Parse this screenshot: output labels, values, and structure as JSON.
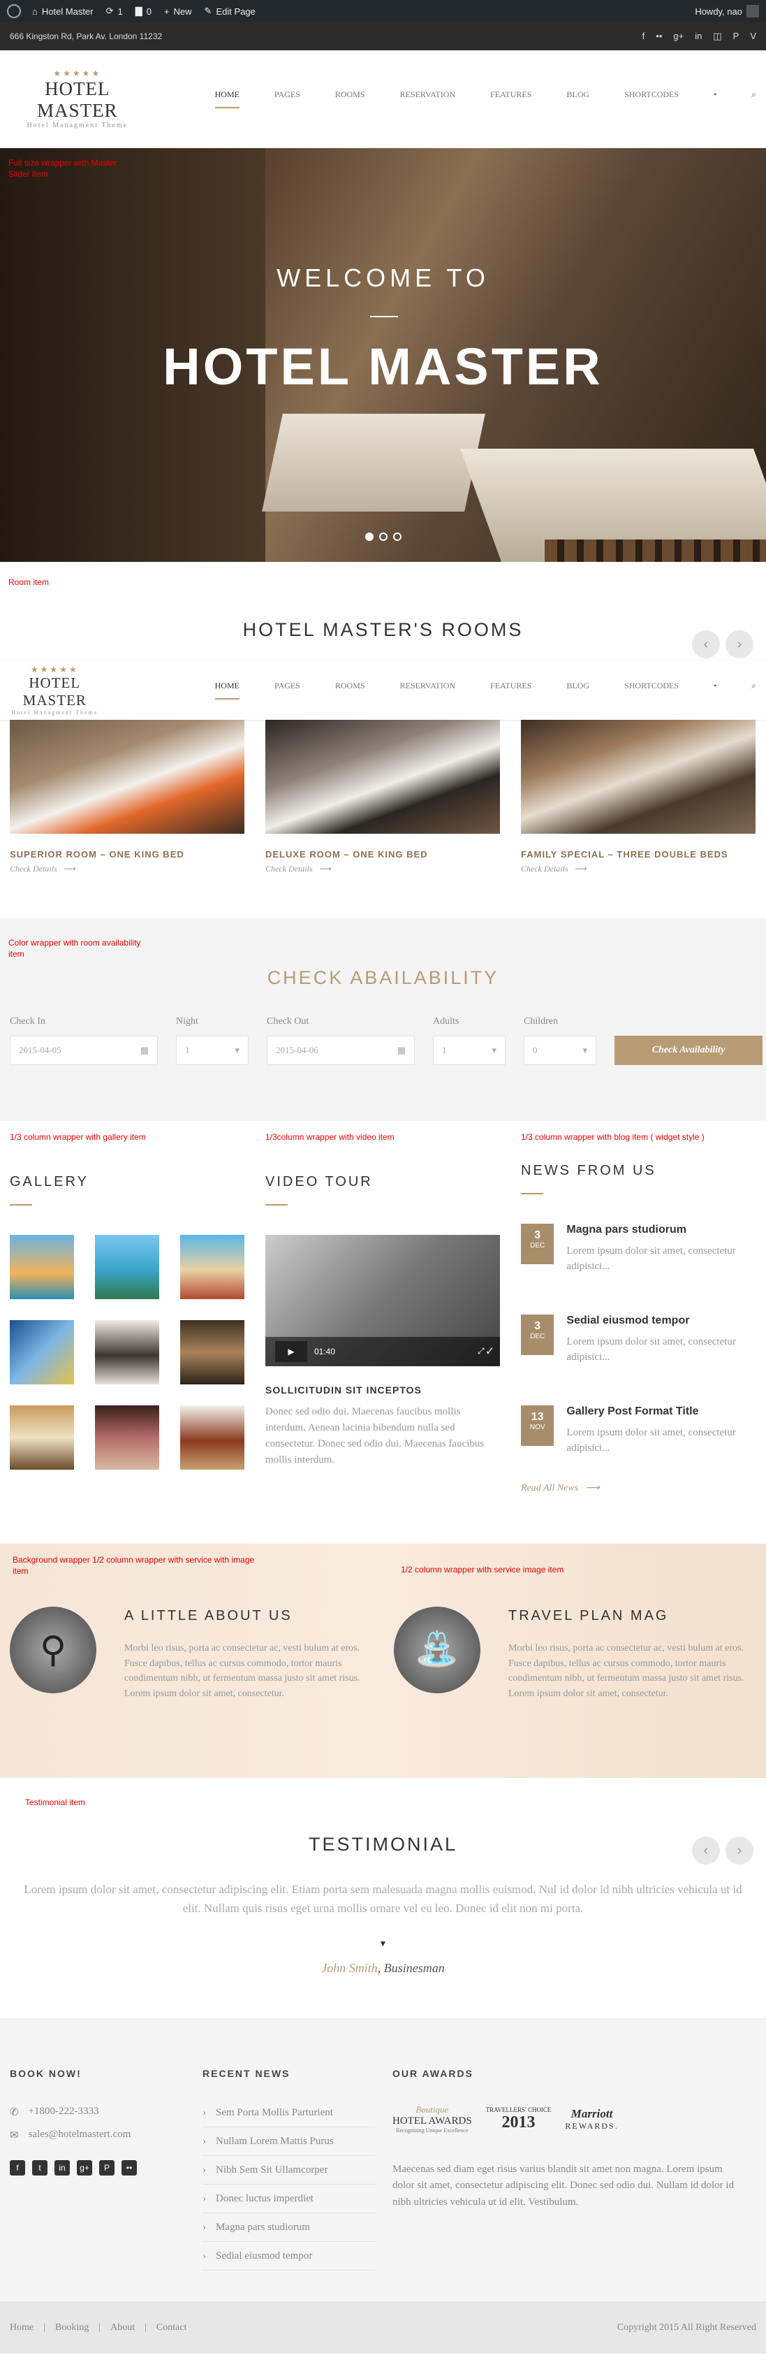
{
  "admin": {
    "site": "Hotel Master",
    "updates": "1",
    "comments": "0",
    "new": "New",
    "edit": "Edit Page",
    "howdy": "Howdy, nao"
  },
  "topbar": {
    "address": "666 Kingston Rd, Park Av. London 11232",
    "social": [
      "f",
      "••",
      "g+",
      "in",
      "◫",
      "P",
      "V"
    ]
  },
  "logo": {
    "stars": "★★★★★",
    "name": "HOTEL MASTER",
    "tagline": "Hotel Managment Theme"
  },
  "nav": {
    "items": [
      "Home",
      "Pages",
      "Rooms",
      "Reservation",
      "Features",
      "Blog",
      "Shortcodes"
    ],
    "dot": "•",
    "search": "⌕"
  },
  "hero": {
    "label": "Full size wrapper with Master Slider item",
    "welcome": "WELCOME TO",
    "title": "HOTEL MASTER"
  },
  "rooms": {
    "label": "Room item",
    "title": "HOTEL MASTER'S ROOMS",
    "prev": "‹",
    "next": "›",
    "items": [
      {
        "title": "SUPERIOR ROOM – ONE KING BED",
        "link": "Check Details"
      },
      {
        "title": "DELUXE ROOM – ONE KING BED",
        "link": "Check Details"
      },
      {
        "title": "FAMILY SPECIAL – THREE DOUBLE BEDS",
        "link": "Check Details"
      }
    ]
  },
  "availability": {
    "label": "Color wrapper with room availability item",
    "title": "CHECK ABAILABILITY",
    "check_in_label": "Check In",
    "check_in": "2015-04-05",
    "night_label": "Night",
    "night": "1",
    "check_out_label": "Check Out",
    "check_out": "2015-04-06",
    "adults_label": "Adults",
    "adults": "1",
    "children_label": "Children",
    "children": "0",
    "button": "Check Availability"
  },
  "gallery": {
    "label": "1/3 column wrapper with gallery item",
    "title": "GALLERY"
  },
  "video": {
    "label": "1/3column wrapper with video item",
    "title": "VIDEO TOUR",
    "time": "01:40",
    "caption": "SOLLICITUDIN SIT INCEPTOS",
    "text": "Donec sed odio dui. Maecenas faucibus mollis interdum. Aenean lacinia bibendum nulla sed consectetur. Donec sed odio dui. Maecenas faucibus mollis interdum."
  },
  "news": {
    "label": "1/3 column wrapper with blog item ( widget style )",
    "title": "NEWS FROM US",
    "items": [
      {
        "day": "3",
        "month": "DEC",
        "title": "Magna pars studiorum",
        "text": "Lorem ipsum dolor sit amet, consectetur adipisici..."
      },
      {
        "day": "3",
        "month": "DEC",
        "title": "Sedial eiusmod tempor",
        "text": "Lorem ipsum dolor sit amet, consectetur adipisici..."
      },
      {
        "day": "13",
        "month": "NOV",
        "title": "Gallery Post Format Title",
        "text": "Lorem ipsum dolor sit amet, consectetur adipisici..."
      }
    ],
    "read_all": "Read All News"
  },
  "service": {
    "label_left": "Background wrapper 1/2 column wrapper with service with image item",
    "label_right": "1/2 column wrapper with service image item",
    "about_title": "A LITTLE ABOUT US",
    "about_text": "Morbi leo risus, porta ac consectetur ac, vesti bulum at eros. Fusce dapibus, tellus ac cursus commodo, tortor mauris condimentum nibh, ut fermentum massa justo sit amet risus. Lorem ipsum dolor sit amet, consectetur.",
    "travel_title": "TRAVEL PLAN MAG",
    "travel_text": "Morbi leo risus, porta ac consectetur ac, vesti bulum at eros. Fusce dapibus, tellus ac cursus commodo, tortor mauris condimentum nibh, ut fermentum massa justo sit amet risus. Lorem ipsum dolor sit amet, consectetur."
  },
  "testimonial": {
    "label": "Testimonial item",
    "title": "TESTIMONIAL",
    "quote": "Lorem ipsum dolor sit amet, consectetur adipiscing elit. Etiam porta sem malesuada magna mollis euismod. Nul id dolor id nibh ultricies vehicula ut id elit. Nullam quis risus eget urna mollis ornare vel eu leo. Donec id elit non mi porta.",
    "name": "John Smith",
    "role": ", Businesman"
  },
  "footer": {
    "book_title": "BOOK NOW!",
    "phone": "+1800-222-3333",
    "email": "sales@hotelmastert.com",
    "social": [
      "f",
      "t",
      "in",
      "g+",
      "P",
      "••"
    ],
    "news_title": "RECENT NEWS",
    "news": [
      "Sem Porta Mollis Parturient",
      "Nullam Lorem Mattis Purus",
      "Nibh Sem Sit Ullamcorper",
      "Donec luctus imperdiet",
      "Magna pars studiorum",
      "Sedial eiusmod tempor"
    ],
    "awards_title": "OUR AWARDS",
    "award1_top": "Boutique",
    "award1_main": "HOTEL AWARDS",
    "award1_sub": "Recognizing Unique Excellence",
    "award2_top": "TRAVELLERS' CHOICE",
    "award2_main": "2013",
    "award3_main": "Marriott",
    "award3_sub": "REWARDS.",
    "awards_text": "Maecenas sed diam eget risus varius blandit sit amet non magna. Lorem ipsum dolor sit amet, consectetur adipiscing elit. Donec sed odio dui. Nullam id dolor id nibh ultricies vehicula ut id elit. Vestibulum."
  },
  "bottom": {
    "links": [
      "Home",
      "Booking",
      "About",
      "Contact"
    ],
    "separator": "|",
    "copyright": "Copyright 2015 All Right Reserved"
  },
  "colors": {
    "accent": "#b89b74",
    "admin_bar": "#23282d",
    "top_bar": "#2b2b2b",
    "label_red": "#ee0000"
  }
}
